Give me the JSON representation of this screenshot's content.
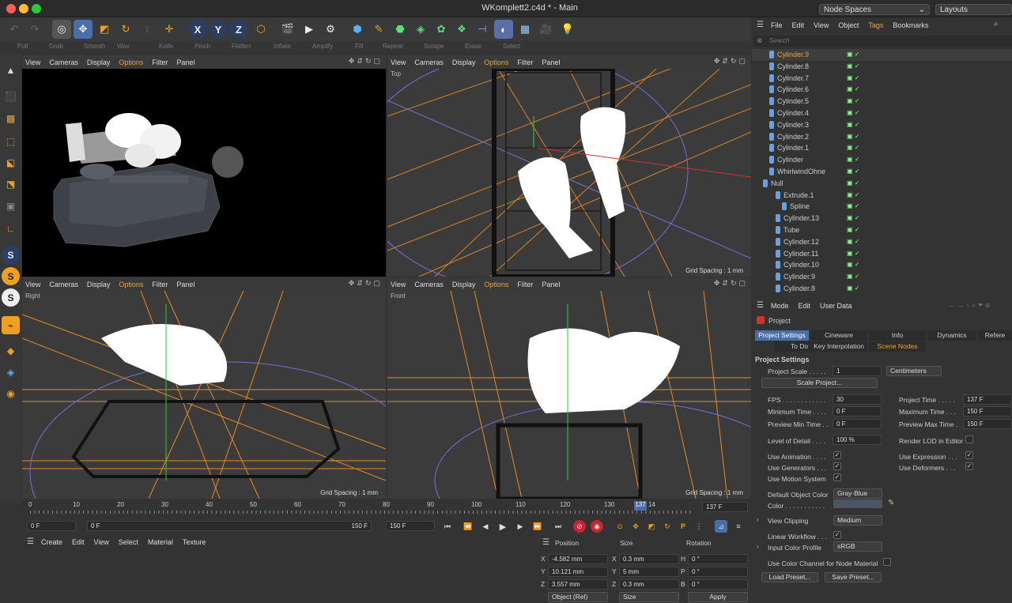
{
  "window": {
    "title": "WKomplett2.c4d * - Main",
    "node_spaces": "Node Spaces",
    "layouts": "Layouts"
  },
  "toolbar2": [
    "Pull",
    "Grab",
    "Smooth",
    "Wax",
    "Knife",
    "Pinch",
    "Flatten",
    "Inflate",
    "Amplify",
    "Fill",
    "Repeat",
    "Scrape",
    "Erase",
    "Select"
  ],
  "viewport_menu": [
    "View",
    "Cameras",
    "Display",
    "Options",
    "Filter",
    "Panel"
  ],
  "viewports": {
    "top_label": "Top",
    "right_label": "Right",
    "front_label": "Front",
    "grid_spacing": "Grid Spacing : 1 mm"
  },
  "timeline": {
    "ticks": [
      "0",
      "10",
      "20",
      "30",
      "40",
      "50",
      "60",
      "70",
      "80",
      "90",
      "100",
      "110",
      "120",
      "130",
      "14"
    ],
    "marker": "137",
    "current_frame": "137 F",
    "start": "0 F",
    "range_start": "0 F",
    "range_end": "150 F",
    "end": "150 F"
  },
  "material_menu": [
    "Create",
    "Edit",
    "View",
    "Select",
    "Material",
    "Texture"
  ],
  "coords": {
    "position_label": "Position",
    "size_label": "Size",
    "rotation_label": "Rotation",
    "x_label": "X",
    "y_label": "Y",
    "z_label": "Z",
    "h_label": "H",
    "p_label": "P",
    "b_label": "B",
    "px": "-4.582 mm",
    "py": "10.121 mm",
    "pz": "3.557 mm",
    "sx": "0.3 mm",
    "sy": "5 mm",
    "sz": "0.3 mm",
    "rh": "0 °",
    "rp": "0 °",
    "rb": "0 °",
    "mode": "Object (Rel)",
    "size_mode": "Size",
    "apply": "Apply"
  },
  "objmenu": [
    "File",
    "Edit",
    "View",
    "Object",
    "Tags",
    "Bookmarks"
  ],
  "search_placeholder": "Search",
  "objects": [
    {
      "name": "Cylinder.9",
      "indent": 1,
      "selected": true
    },
    {
      "name": "Cylinder.8",
      "indent": 1
    },
    {
      "name": "Cylinder.7",
      "indent": 1
    },
    {
      "name": "Cylinder.6",
      "indent": 1
    },
    {
      "name": "Cylinder.5",
      "indent": 1
    },
    {
      "name": "Cylinder.4",
      "indent": 1
    },
    {
      "name": "Cylinder.3",
      "indent": 1
    },
    {
      "name": "Cylinder.2",
      "indent": 1
    },
    {
      "name": "Cylinder.1",
      "indent": 1
    },
    {
      "name": "Cylinder",
      "indent": 1
    },
    {
      "name": "WhirlwindOhne",
      "indent": 1
    },
    {
      "name": "Null",
      "indent": 0
    },
    {
      "name": "Extrude.1",
      "indent": 2
    },
    {
      "name": "Spline",
      "indent": 3
    },
    {
      "name": "Cylinder.13",
      "indent": 2
    },
    {
      "name": "Tube",
      "indent": 2
    },
    {
      "name": "Cylinder.12",
      "indent": 2
    },
    {
      "name": "Cylinder.11",
      "indent": 2
    },
    {
      "name": "Cylinder.10",
      "indent": 2
    },
    {
      "name": "Cylinder.9",
      "indent": 2
    },
    {
      "name": "Cylinder.8",
      "indent": 2
    }
  ],
  "attr": {
    "menu": [
      "Mode",
      "Edit",
      "User Data"
    ],
    "object": "Project",
    "tabs1": [
      "Project Settings",
      "Cineware",
      "Info",
      "Dynamics",
      "Refere"
    ],
    "tabs2": [
      "To Do",
      "Key Interpolation",
      "Scene Nodes"
    ],
    "section": "Project Settings",
    "project_scale_label": "Project Scale . . . . .",
    "project_scale": "1",
    "units": "Centimeters",
    "scale_project": "Scale Project...",
    "fps_label": "FPS . . . . . . . . . . . .",
    "fps": "30",
    "project_time_label": "Project Time . . . . .",
    "project_time": "137 F",
    "min_time_label": "Minimum Time . . . .",
    "min_time": "0 F",
    "max_time_label": "Maximum Time . . .",
    "max_time": "150 F",
    "prev_min_label": "Preview Min Time . .",
    "prev_min": "0 F",
    "prev_max_label": "Preview Max Time .",
    "prev_max": "150 F",
    "lod_label": "Level of Detail . . . .",
    "lod": "100 %",
    "render_lod_label": "Render LOD in Editor",
    "use_animation": "Use Animation . . . .",
    "use_expression": "Use Expression . . .",
    "use_generators": "Use Generators . . .",
    "use_deformers": "Use Deformers . . .",
    "use_motion": "Use Motion System",
    "default_color_label": "Default Object Color",
    "default_color": "Gray-Blue",
    "color_label": "Color . . . . . . . . . . .",
    "view_clipping_label": "View Clipping",
    "view_clipping": "Medium",
    "linear_workflow": "Linear Workflow . . .",
    "input_profile_label": "Input Color Profile",
    "input_profile": "sRGB",
    "color_channel": "Use Color Channel for Node Material",
    "load_preset": "Load Preset...",
    "save_preset": "Save Preset..."
  }
}
